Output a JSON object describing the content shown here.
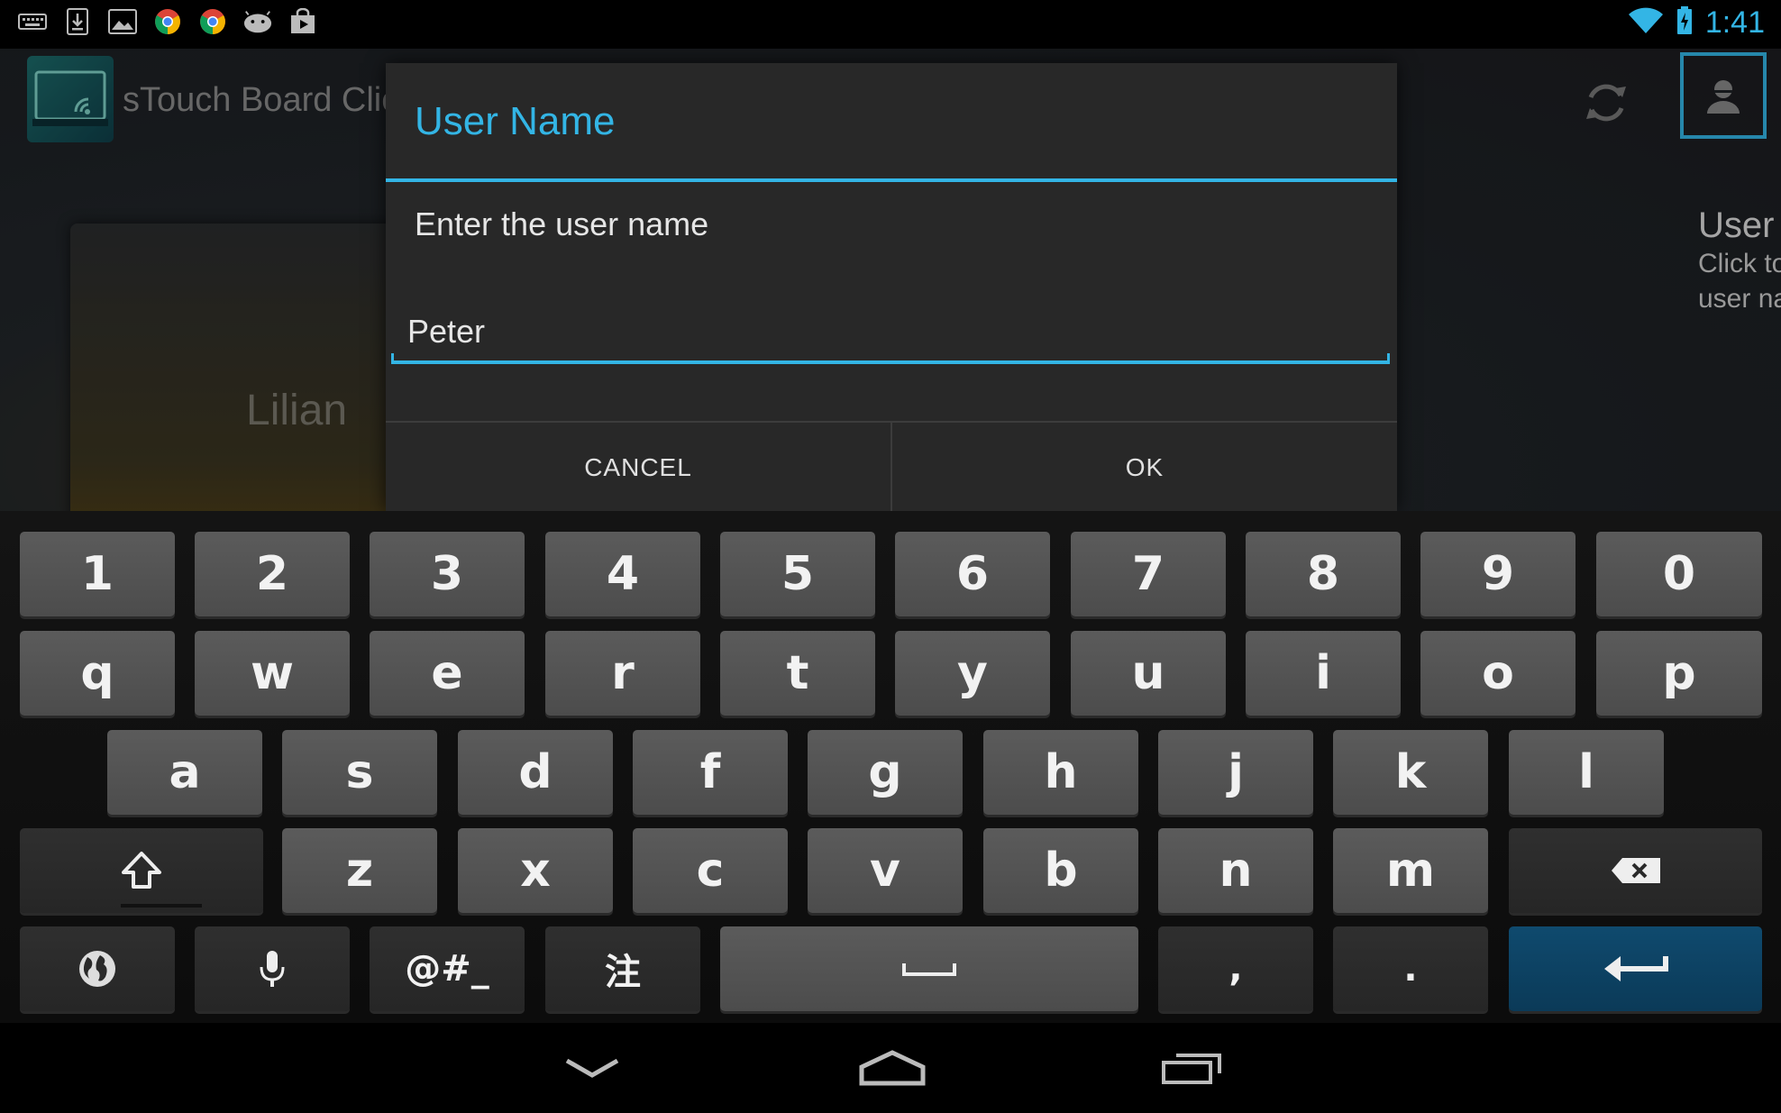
{
  "status_bar": {
    "notification_icons": [
      "keyboard-icon",
      "download-icon",
      "image-icon",
      "chrome-icon",
      "chrome-icon",
      "android-icon",
      "play-store-icon"
    ],
    "time": "1:41"
  },
  "app": {
    "title": "sTouch Board Clie",
    "card_name": "Lilian",
    "user_hint": {
      "title": "User",
      "desc_line1": "Click to",
      "desc_line2": "user na"
    },
    "accent_color": "#33b5e5"
  },
  "dialog": {
    "title": "User Name",
    "message": "Enter the user name",
    "input_value": "Peter",
    "cancel_label": "CANCEL",
    "ok_label": "OK"
  },
  "keyboard": {
    "row1": [
      "1",
      "2",
      "3",
      "4",
      "5",
      "6",
      "7",
      "8",
      "9",
      "0"
    ],
    "row2": [
      "q",
      "w",
      "e",
      "r",
      "t",
      "y",
      "u",
      "i",
      "o",
      "p"
    ],
    "row3": [
      "a",
      "s",
      "d",
      "f",
      "g",
      "h",
      "j",
      "k",
      "l"
    ],
    "row4": [
      "z",
      "x",
      "c",
      "v",
      "b",
      "n",
      "m"
    ],
    "symbols_label": "@#_",
    "zhuyin_label": "注",
    "comma_label": ",",
    "period_label": "."
  },
  "navbar": {
    "buttons": [
      "back-icon",
      "home-icon",
      "recents-icon"
    ]
  }
}
